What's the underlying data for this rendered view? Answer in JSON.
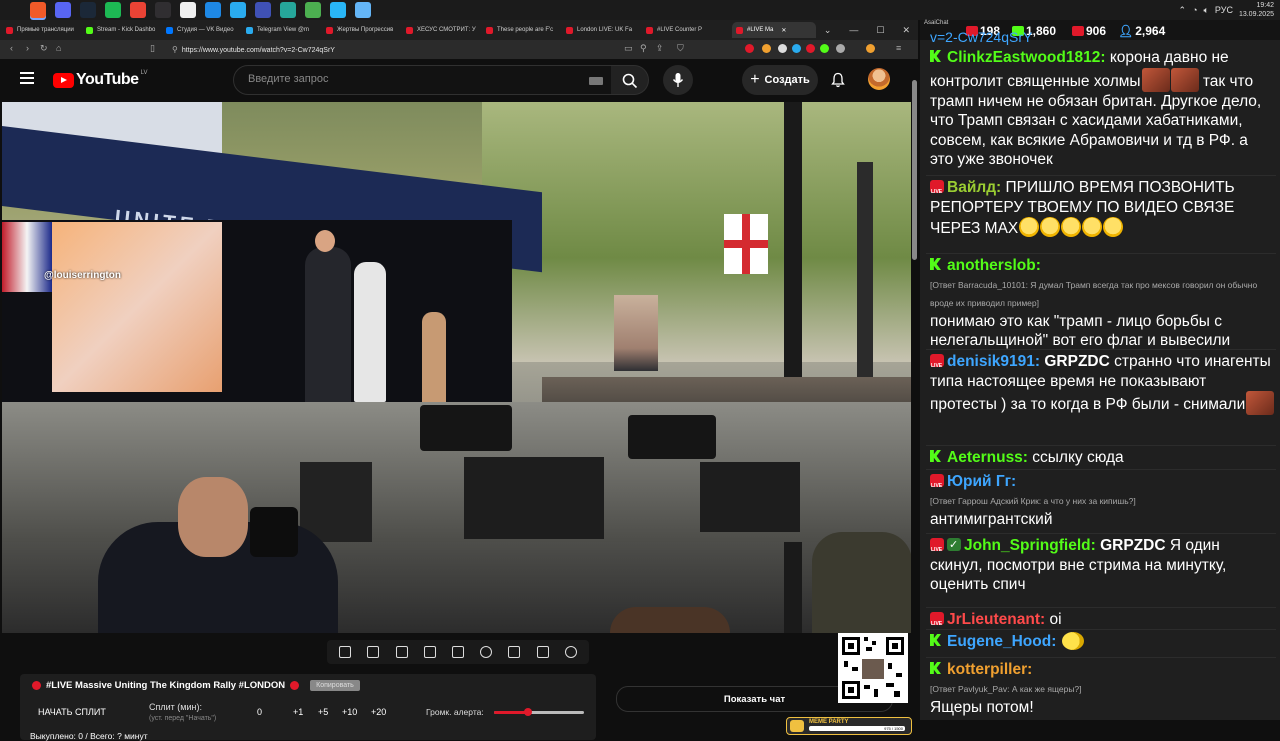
{
  "taskbar": {
    "apps": [
      {
        "icon": "brave-icon",
        "color": "#f15a29",
        "active": true
      },
      {
        "icon": "discord-icon",
        "color": "#5865f2",
        "active": false
      },
      {
        "icon": "steam-icon",
        "color": "#1b2838",
        "active": false
      },
      {
        "icon": "spotify-icon",
        "color": "#1db954",
        "active": false
      },
      {
        "icon": "chrome-icon",
        "color": "#ea4335",
        "active": false
      },
      {
        "icon": "obs-icon",
        "color": "#302e31",
        "active": false
      },
      {
        "icon": "capcut-icon",
        "color": "#eeeeee",
        "active": false
      },
      {
        "icon": "browser2-icon",
        "color": "#1e88e5",
        "active": false
      },
      {
        "icon": "telegram-icon",
        "color": "#2aabee",
        "active": false
      },
      {
        "icon": "media-icon",
        "color": "#3f51b5",
        "active": false
      },
      {
        "icon": "green-app-icon",
        "color": "#26a69a",
        "active": false
      },
      {
        "icon": "notes-icon",
        "color": "#4caf50",
        "active": false
      },
      {
        "icon": "telegram2-icon",
        "color": "#29b6f6",
        "active": false
      },
      {
        "icon": "telegram3-icon",
        "color": "#64b5f6",
        "active": false
      }
    ],
    "lang": "РУС",
    "time": "19:42",
    "date": "13.09.2025"
  },
  "browser": {
    "tabs": [
      {
        "label": "Прямые трансляции",
        "color": "#e0192a",
        "active": false
      },
      {
        "label": "Stream - Kick Dashbo",
        "color": "#53fc18",
        "active": false
      },
      {
        "label": "Студия — VK Видео",
        "color": "#0077ff",
        "active": false
      },
      {
        "label": "Telegram View @m",
        "color": "#2aabee",
        "active": false
      },
      {
        "label": "Жертвы Прогрессив",
        "color": "#e0192a",
        "active": false
      },
      {
        "label": "ХЕСУС СМОТРИТ: У",
        "color": "#e0192a",
        "active": false
      },
      {
        "label": "These people are F'c",
        "color": "#e0192a",
        "active": false
      },
      {
        "label": "London LIVE: UK Fa",
        "color": "#e0192a",
        "active": false
      },
      {
        "label": "#LIVE Counter P",
        "color": "#e0192a",
        "active": false
      },
      {
        "label": "#LIVE Ma",
        "color": "#e0192a",
        "active": true
      }
    ],
    "url": "https://www.youtube.com/watch?v=2-Cw724qSrY"
  },
  "youtube": {
    "logo_text": "YouTube",
    "country": "LV",
    "search_placeholder": "Введите запрос",
    "create_label": "Создать"
  },
  "video": {
    "watermark": "@louiserrington",
    "banner": "UNITE THE KINGDOM"
  },
  "controls": {
    "icons": [
      "loop-icon",
      "broadcast-icon",
      "pip-icon",
      "theater-icon",
      "frame-icon",
      "speed-icon",
      "add-clip-icon",
      "screenshot-icon",
      "settings-icon"
    ]
  },
  "panel": {
    "title": "#LIVE Massive Uniting The Kingdom Rally #LONDON",
    "copy_label": "Копировать",
    "split_button": "НАЧАТЬ СПЛИТ",
    "split_label": "Сплит (мин):",
    "split_sub": "(уст. перед \"Начать\")",
    "split_value": "0",
    "increments": [
      "+1",
      "+5",
      "+10",
      "+20"
    ],
    "alert_label": "Громк. алерта:",
    "alert_level": 0.38,
    "bought": "Выкуплено: 0 / Всего: ? минут"
  },
  "show_chat_label": "Показать чат",
  "meme": {
    "tag": "MEME PARTY",
    "progress": "975 / 1500"
  },
  "chat": {
    "app_name": "AsaiChat",
    "stats": [
      {
        "platform": "youtube",
        "color": "#e0192a",
        "value": "198"
      },
      {
        "platform": "kick",
        "color": "#53fc18",
        "value": "1,860"
      },
      {
        "platform": "vk",
        "color": "#e0192a",
        "value": "906"
      },
      {
        "platform": "total",
        "color": "#3ea6ff",
        "value": "2,964"
      }
    ],
    "cut_text": "v=2-Cw724qSrY",
    "messages": [
      {
        "badge": "kick",
        "user": "ClinkzEastwood1812:",
        "color": "#53fc18",
        "text": "корона давно не контролит священные холмы",
        "emotes": 2,
        "text2": "так что трамп ничем не обязан британ. Другкое дело, что Трамп связан с хасидами хабатниками, совсем, как всякие Абрамовичи и тд в РФ. а это уже звоночек"
      },
      {
        "badge": "live",
        "user": "Вайлд:",
        "color": "#9acd32",
        "text": "ПРИШЛО ВРЕМЯ ПОЗВОНИТЬ РЕПОРТЕРУ ТВОЕМУ ПО ВИДЕО СВЯЗЕ ЧЕРЕЗ MAX",
        "emotes": 5
      },
      {
        "badge": "kick",
        "user": "anotherslob:",
        "color": "#53fc18",
        "reply": "[Ответ Barracuda_10101: Я думал Трамп всегда так про мексов говорил он обычно вроде их приводил пример]",
        "text": "понимаю это как \"трамп - лицо борьбы с нелегальщиной\" вот его флаг и вывесили"
      },
      {
        "badge": "live",
        "user": "denisik9191:",
        "color": "#3ea6ff",
        "mention": "GRPZDC",
        "text": "странно что инагенты типа настоящее время не показывают протесты ) за то когда в РФ были - снимали",
        "emotes": 1
      },
      {
        "badge": "kick",
        "user": "Aeternuss:",
        "color": "#53fc18",
        "text": "ссылку сюда"
      },
      {
        "badge": "live",
        "user": "Юрий Гг:",
        "color": "#3ea6ff",
        "reply": "[Ответ Гаррош Адский Крик: а что у них за кипишь?]",
        "text": "антимигрантский"
      },
      {
        "badge": "live",
        "badge2": "check",
        "user": "John_Springfield:",
        "color": "#53fc18",
        "mention": "GRPZDC",
        "text": "Я один скинул, посмотри вне стрима на минутку, оценить спич"
      },
      {
        "badge": "live",
        "user": "JrLieutenant:",
        "color": "#ff4a4a",
        "text": "oi"
      },
      {
        "badge": "kick",
        "user": "Eugene_Hood:",
        "color": "#3ea6ff",
        "text": "",
        "emotes": 1
      },
      {
        "badge": "kick",
        "user": "kotterpiller:",
        "color": "#f0a030",
        "reply": "[Ответ Pavlyuk_Pav: А как же ящеры?]",
        "text": "Ящеры потом!"
      }
    ]
  }
}
